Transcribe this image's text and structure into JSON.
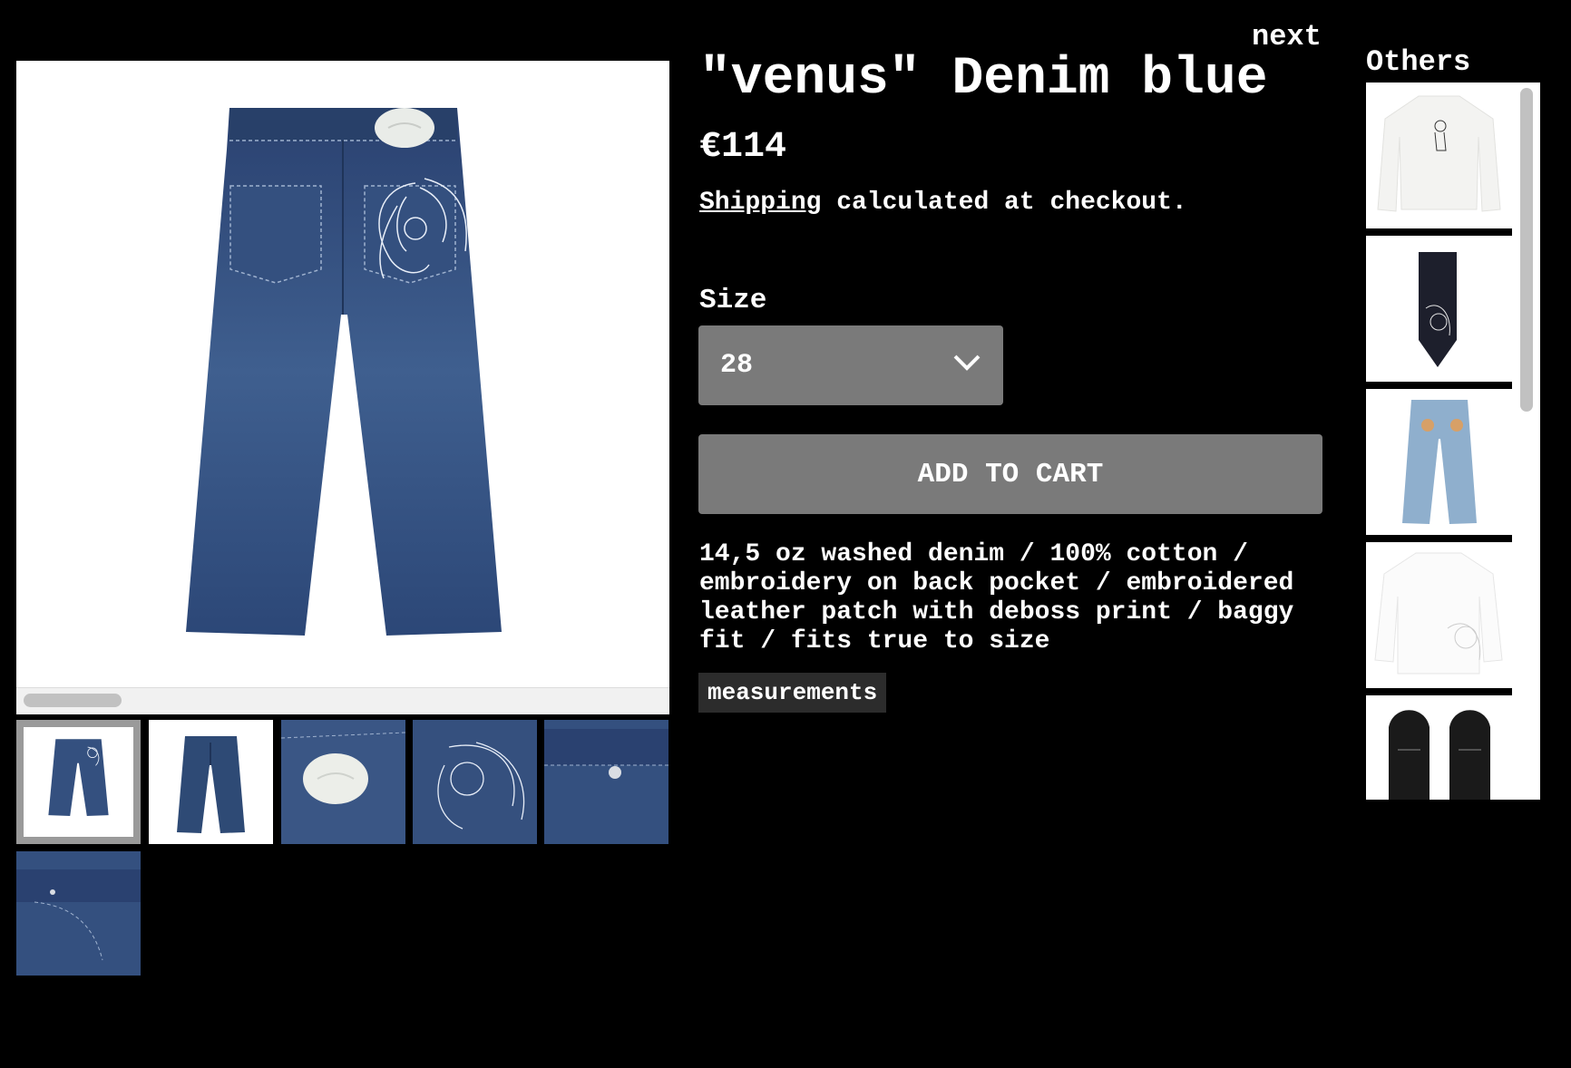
{
  "nav": {
    "next_label": "next"
  },
  "product": {
    "title": "\"venus\" Denim blue",
    "price": "€114",
    "shipping_link": "Shipping",
    "shipping_rest": " calculated at checkout.",
    "size_label": "Size",
    "size_selected": "28",
    "add_to_cart": "ADD TO CART",
    "description": "14,5 oz washed denim / 100% cotton / embroidery on back pocket / embroidered leather patch with deboss print / baggy fit / fits true to size",
    "measurements_label": "measurements"
  },
  "gallery": {
    "main_image": "denim-jeans-back-view",
    "thumbnails": [
      {
        "name": "jeans-back-full",
        "active": true
      },
      {
        "name": "jeans-front-full",
        "active": false
      },
      {
        "name": "leather-patch-closeup",
        "active": false
      },
      {
        "name": "embroidered-pocket-closeup",
        "active": false
      },
      {
        "name": "waistband-button-closeup",
        "active": false
      },
      {
        "name": "front-pocket-closeup",
        "active": false
      }
    ]
  },
  "others": {
    "heading": "Others",
    "items": [
      {
        "name": "white-longsleeve-tee"
      },
      {
        "name": "black-embroidered-tie"
      },
      {
        "name": "light-blue-jeans"
      },
      {
        "name": "white-embroidered-shirt"
      },
      {
        "name": "black-loafers"
      }
    ]
  },
  "colors": {
    "background": "#000000",
    "denim_dark": "#2e4a75",
    "button_gray": "#7a7a7a"
  }
}
